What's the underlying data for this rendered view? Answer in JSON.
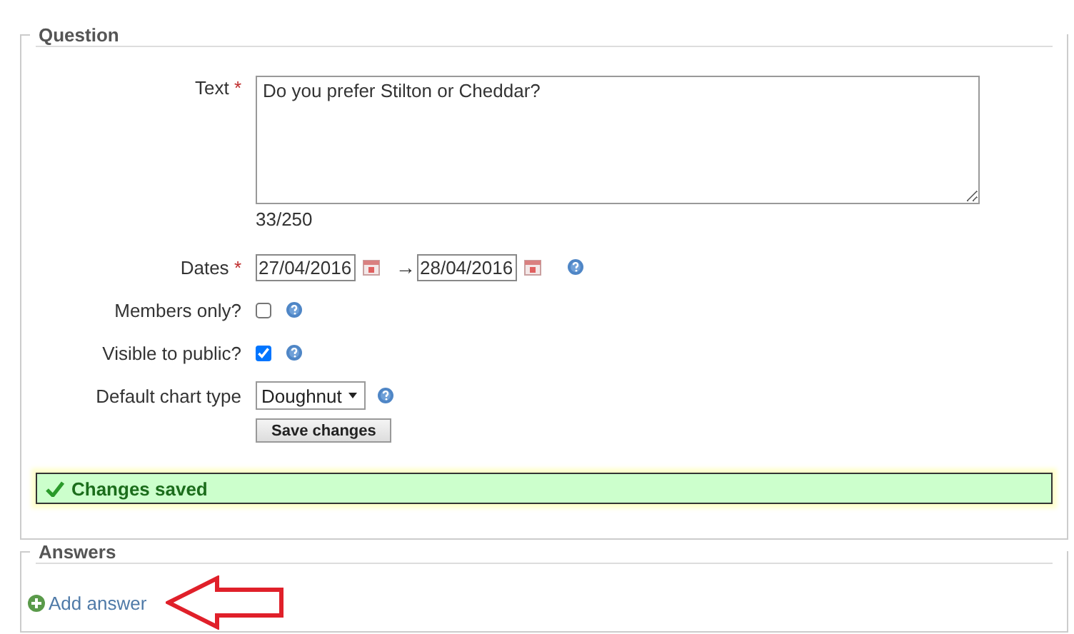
{
  "question": {
    "legend": "Question",
    "fields": [
      {
        "kind": "textarea",
        "label": "Text",
        "required_mark": "*",
        "value": "Do you prefer Stilton or Cheddar?",
        "counter": "33/250"
      },
      {
        "kind": "daterange",
        "label": "Dates",
        "required_mark": "*",
        "from": "27/04/2016",
        "arrow": "→",
        "to": "28/04/2016"
      },
      {
        "kind": "checkbox",
        "label": "Members only?",
        "checked": false
      },
      {
        "kind": "checkbox",
        "label": "Visible to public?",
        "checked": true
      },
      {
        "kind": "select",
        "label": "Default chart type",
        "value": "Doughnut"
      }
    ],
    "save_button": "Save changes",
    "message": "Changes saved"
  },
  "answers": {
    "legend": "Answers",
    "add_link": "Add answer"
  }
}
